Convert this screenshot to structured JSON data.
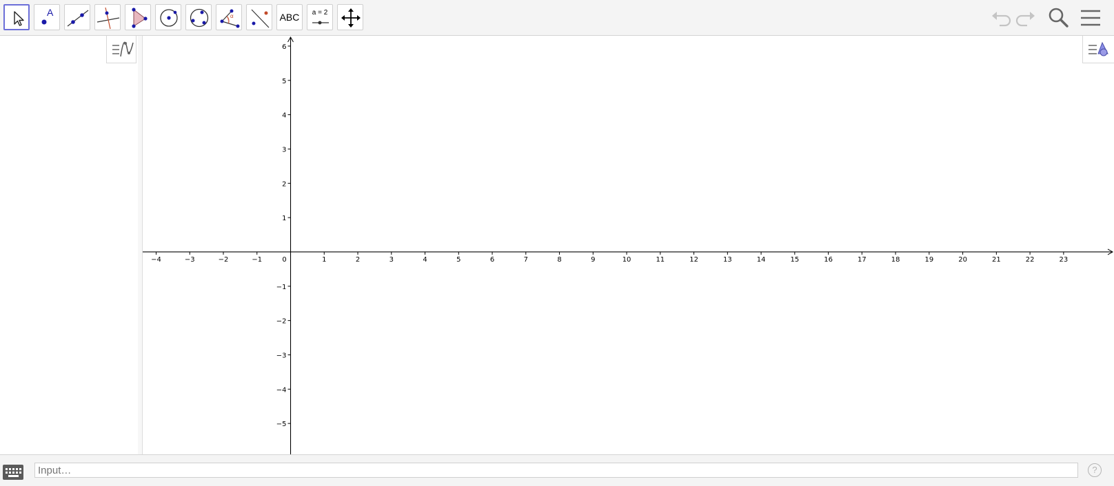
{
  "toolbar": {
    "tools": [
      {
        "name": "move-tool",
        "label": ""
      },
      {
        "name": "point-tool",
        "label": "A"
      },
      {
        "name": "line-tool",
        "label": ""
      },
      {
        "name": "perpendicular-tool",
        "label": ""
      },
      {
        "name": "polygon-tool",
        "label": ""
      },
      {
        "name": "circle-center-point-tool",
        "label": ""
      },
      {
        "name": "circle-three-points-tool",
        "label": ""
      },
      {
        "name": "angle-tool",
        "label": "α"
      },
      {
        "name": "reflect-tool",
        "label": ""
      },
      {
        "name": "text-tool",
        "label": "ABC"
      },
      {
        "name": "slider-tool",
        "label": "a = 2"
      },
      {
        "name": "move-graphics-view-tool",
        "label": ""
      }
    ],
    "selected_tool": "move-tool",
    "right_icons": [
      "undo-icon",
      "redo-icon",
      "search-icon",
      "menu-icon"
    ]
  },
  "graph": {
    "x_ticks": [
      "−4",
      "−3",
      "−2",
      "−1",
      "0",
      "1",
      "2",
      "3",
      "4",
      "5",
      "6",
      "7",
      "8",
      "9",
      "10",
      "11",
      "12",
      "13",
      "14",
      "15",
      "16",
      "17",
      "18",
      "19",
      "20",
      "21",
      "22",
      "23"
    ],
    "y_ticks": [
      "6",
      "5",
      "4",
      "3",
      "2",
      "1",
      "−1",
      "−2",
      "−3",
      "−4",
      "−5"
    ],
    "x_range": [
      -4.4,
      24.5
    ],
    "y_range": [
      -5.9,
      6.3
    ],
    "grid": false
  },
  "input_bar": {
    "placeholder": "Input…",
    "help_label": "?"
  },
  "colors": {
    "accent": "#6b6ed8",
    "point": "#1a1aa8",
    "toolbar_bg": "#f4f4f4"
  }
}
